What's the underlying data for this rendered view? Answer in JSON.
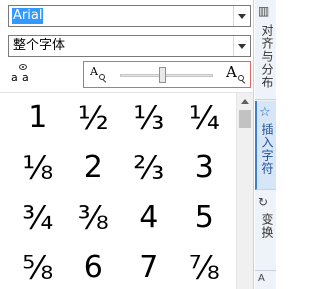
{
  "font_selector": {
    "value": "Arial"
  },
  "filter_selector": {
    "value": "整个字体"
  },
  "toolbar": {
    "char_info_label_1": "a",
    "char_info_label_2": "a"
  },
  "zoom": {
    "small_glyph": "A",
    "large_glyph": "A",
    "level_fraction": 0.45
  },
  "glyphs": [
    [
      "1",
      "½",
      "⅓",
      "¼"
    ],
    [
      "⅛",
      "2",
      "⅔",
      "3"
    ],
    [
      "¾",
      "⅜",
      "4",
      "5"
    ],
    [
      "⅝",
      "6",
      "7",
      "⅞"
    ]
  ],
  "side_tabs": {
    "align": {
      "label": "对齐与分布",
      "icon": "align-icon"
    },
    "insert": {
      "label": "插入字符",
      "icon": "star-icon"
    },
    "transform": {
      "label": "变换",
      "icon": "transform-icon"
    },
    "more": {
      "icon": "text-icon",
      "label": "A"
    }
  },
  "colors": {
    "selection": "#3399ff",
    "zoom_border": "#e06666",
    "active_tab": "#d6e6f7"
  }
}
